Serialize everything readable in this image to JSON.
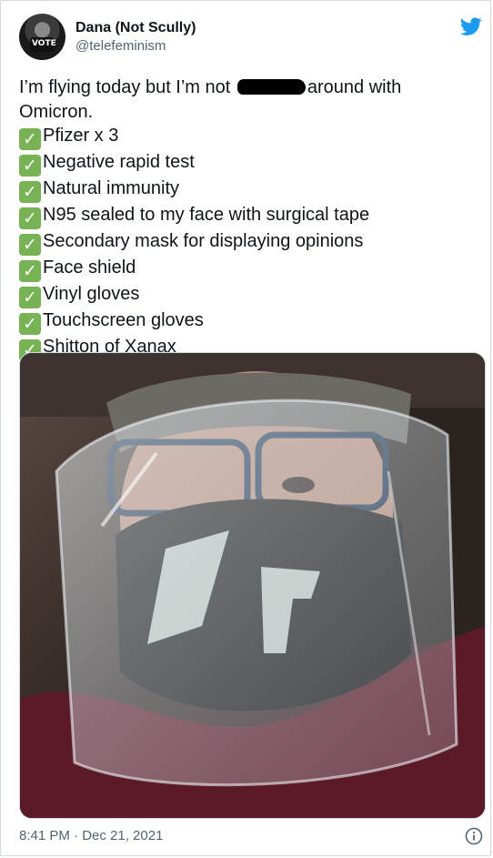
{
  "user": {
    "display_name": "Dana (Not Scully)",
    "handle": "@telefeminism",
    "avatar_text": "VOTE"
  },
  "icons": {
    "brand": "twitter-bird-icon",
    "check": "white-check-mark-icon",
    "info": "info-icon"
  },
  "colors": {
    "twitter_blue": "#1d9bf0",
    "check_green": "#77b255",
    "secondary_text": "#536471"
  },
  "tweet": {
    "line1_before": "I’m flying today but I’m not ",
    "line1_after": "around with",
    "line2": "Omicron.",
    "checklist": [
      "Pfizer x 3",
      "Negative rapid test",
      "Natural immunity",
      "N95 sealed to my face with surgical tape",
      "Secondary mask for displaying opinions",
      "Face shield",
      "Vinyl gloves",
      "Touchscreen gloves",
      "Shitton of Xanax"
    ],
    "check_glyph": "✓"
  },
  "footer": {
    "timestamp": "8:41 PM · Dec 21, 2021"
  }
}
